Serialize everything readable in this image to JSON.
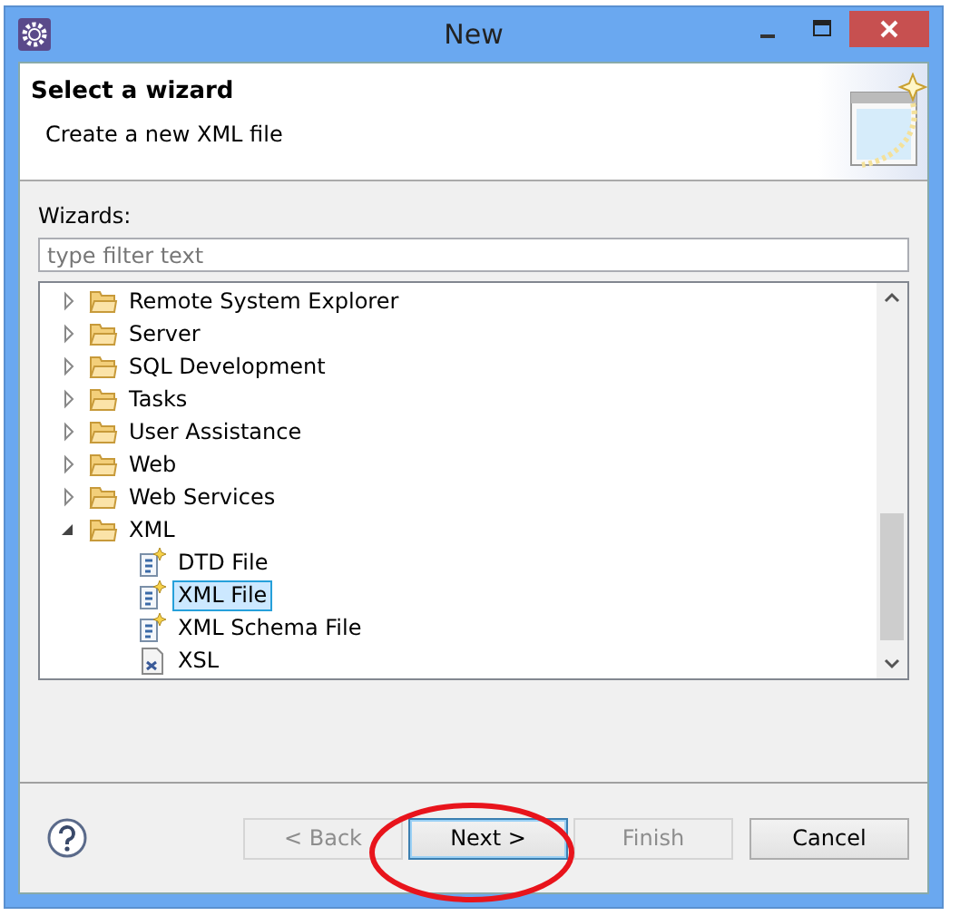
{
  "window": {
    "title": "New"
  },
  "header": {
    "title": "Select a wizard",
    "description": "Create a new XML file"
  },
  "wizards": {
    "label": "Wizards:",
    "filter": {
      "placeholder": "type filter text"
    },
    "tree": [
      {
        "label": "Remote System Explorer",
        "kind": "folder",
        "expanded": false,
        "selected": false
      },
      {
        "label": "Server",
        "kind": "folder",
        "expanded": false,
        "selected": false
      },
      {
        "label": "SQL Development",
        "kind": "folder",
        "expanded": false,
        "selected": false
      },
      {
        "label": "Tasks",
        "kind": "folder",
        "expanded": false,
        "selected": false
      },
      {
        "label": "User Assistance",
        "kind": "folder",
        "expanded": false,
        "selected": false
      },
      {
        "label": "Web",
        "kind": "folder",
        "expanded": false,
        "selected": false
      },
      {
        "label": "Web Services",
        "kind": "folder",
        "expanded": false,
        "selected": false
      },
      {
        "label": "XML",
        "kind": "folder",
        "expanded": true,
        "selected": false,
        "children": [
          {
            "label": "DTD File",
            "kind": "wizard",
            "selected": false
          },
          {
            "label": "XML File",
            "kind": "wizard",
            "selected": true
          },
          {
            "label": "XML Schema File",
            "kind": "wizard",
            "selected": false
          },
          {
            "label": "XSL",
            "kind": "stylesheet",
            "selected": false
          }
        ]
      }
    ]
  },
  "buttons": [
    {
      "label": "< Back",
      "disabled": true,
      "focused": false
    },
    {
      "label": "Next >",
      "disabled": false,
      "focused": true
    },
    {
      "label": "Finish",
      "disabled": true,
      "focused": false
    },
    {
      "label": "Cancel",
      "disabled": false,
      "focused": false
    }
  ]
}
